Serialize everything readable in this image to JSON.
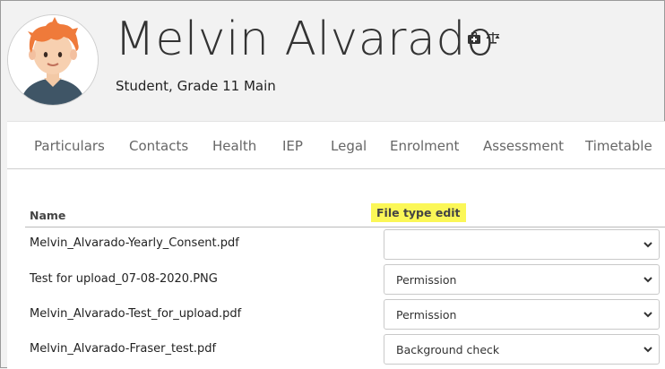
{
  "profile": {
    "name": "Melvin Alvarado",
    "subtitle": "Student, Grade 11 Main",
    "icons": [
      "medical-kit-icon",
      "scales-icon"
    ]
  },
  "tabs": [
    {
      "label": "Particulars"
    },
    {
      "label": "Contacts"
    },
    {
      "label": "Health"
    },
    {
      "label": "IEP"
    },
    {
      "label": "Legal"
    },
    {
      "label": "Enrolment"
    },
    {
      "label": "Assessment"
    },
    {
      "label": "Timetable"
    }
  ],
  "table": {
    "name_header": "Name",
    "type_header": "File type edit",
    "rows": [
      {
        "name": "Melvin_Alvarado-Yearly_Consent.pdf",
        "file_type": ""
      },
      {
        "name": "Test for upload_07-08-2020.PNG",
        "file_type": "Permission"
      },
      {
        "name": "Melvin_Alvarado-Test_for_upload.pdf",
        "file_type": "Permission"
      },
      {
        "name": "Melvin_Alvarado-Fraser_test.pdf",
        "file_type": "Background check"
      }
    ]
  },
  "colors": {
    "highlight": "#fbf757",
    "background": "#f2f2f2"
  }
}
